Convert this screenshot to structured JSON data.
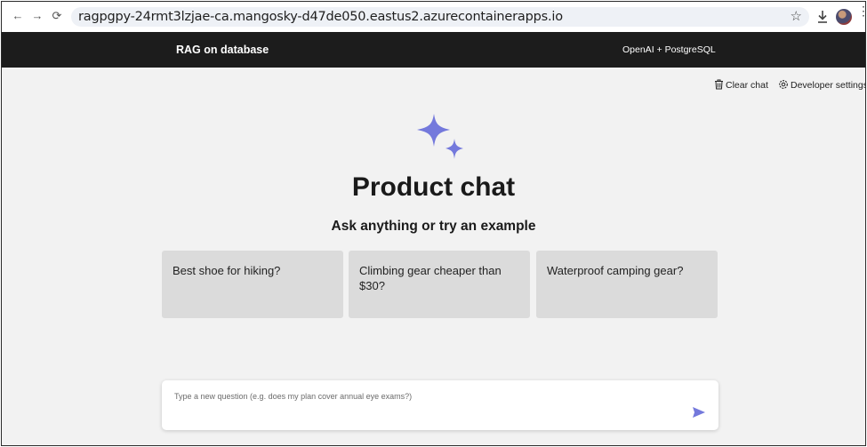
{
  "browser": {
    "url": "ragpgpy-24rmt3lzjae-ca.mangosky-d47de050.eastus2.azurecontainerapps.io",
    "back_icon": "←",
    "forward_icon": "→",
    "reload_icon": "⟳",
    "bookmark_icon": "☆",
    "download_icon": "download-icon",
    "menu_icon": "⋮"
  },
  "header": {
    "title": "RAG on database",
    "subtitle": "OpenAI + PostgreSQL"
  },
  "commands": {
    "clear_chat": "Clear chat",
    "developer_settings": "Developer settings"
  },
  "hero": {
    "title": "Product chat",
    "subtitle": "Ask anything or try an example"
  },
  "examples": [
    {
      "text": "Best shoe for hiking?"
    },
    {
      "text": "Climbing gear cheaper than $30?"
    },
    {
      "text": "Waterproof camping gear?"
    }
  ],
  "question": {
    "placeholder": "Type a new question (e.g. does my plan cover annual eye exams?)",
    "value": ""
  },
  "colors": {
    "accent": "#7479dc",
    "header_bg": "#1c1c1c",
    "page_bg": "#f2f2f2",
    "card_bg": "#dbdbdb"
  }
}
